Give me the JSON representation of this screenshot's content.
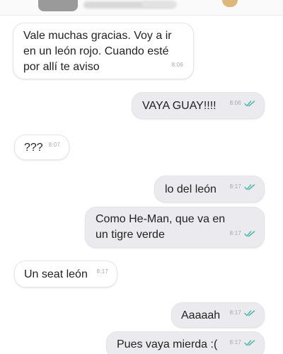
{
  "header": {
    "avatar_icon": "contact-avatar-icon",
    "emoji_icon": "face-emoji-icon"
  },
  "colors": {
    "incoming_bubble": "#ffffff",
    "outgoing_bubble": "#ebebef",
    "read_ticks": "#4fb8a9",
    "timestamp": "#a9a9a9"
  },
  "messages": [
    {
      "direction": "in",
      "text": "Vale muchas gracias. Voy a ir\nen un león rojo. Cuando esté\npor allí te aviso",
      "time": "8:06"
    },
    {
      "direction": "out",
      "text": "VAYA GUAY!!!!",
      "time": "8:06",
      "status": "read"
    },
    {
      "direction": "in",
      "text": "???",
      "time": "8:07"
    },
    {
      "direction": "out",
      "text": "lo del león",
      "time": "8:17",
      "status": "read"
    },
    {
      "direction": "out",
      "text": "Como He-Man, que va en\nun tigre verde",
      "time": "8:17",
      "status": "read"
    },
    {
      "direction": "in",
      "text": "Un seat león",
      "time": "8:17"
    },
    {
      "direction": "out",
      "text": "Aaaaah",
      "time": "8:17",
      "status": "read"
    },
    {
      "direction": "out",
      "text": "Pues vaya mierda :(",
      "time": "8:17",
      "status": "read"
    }
  ]
}
